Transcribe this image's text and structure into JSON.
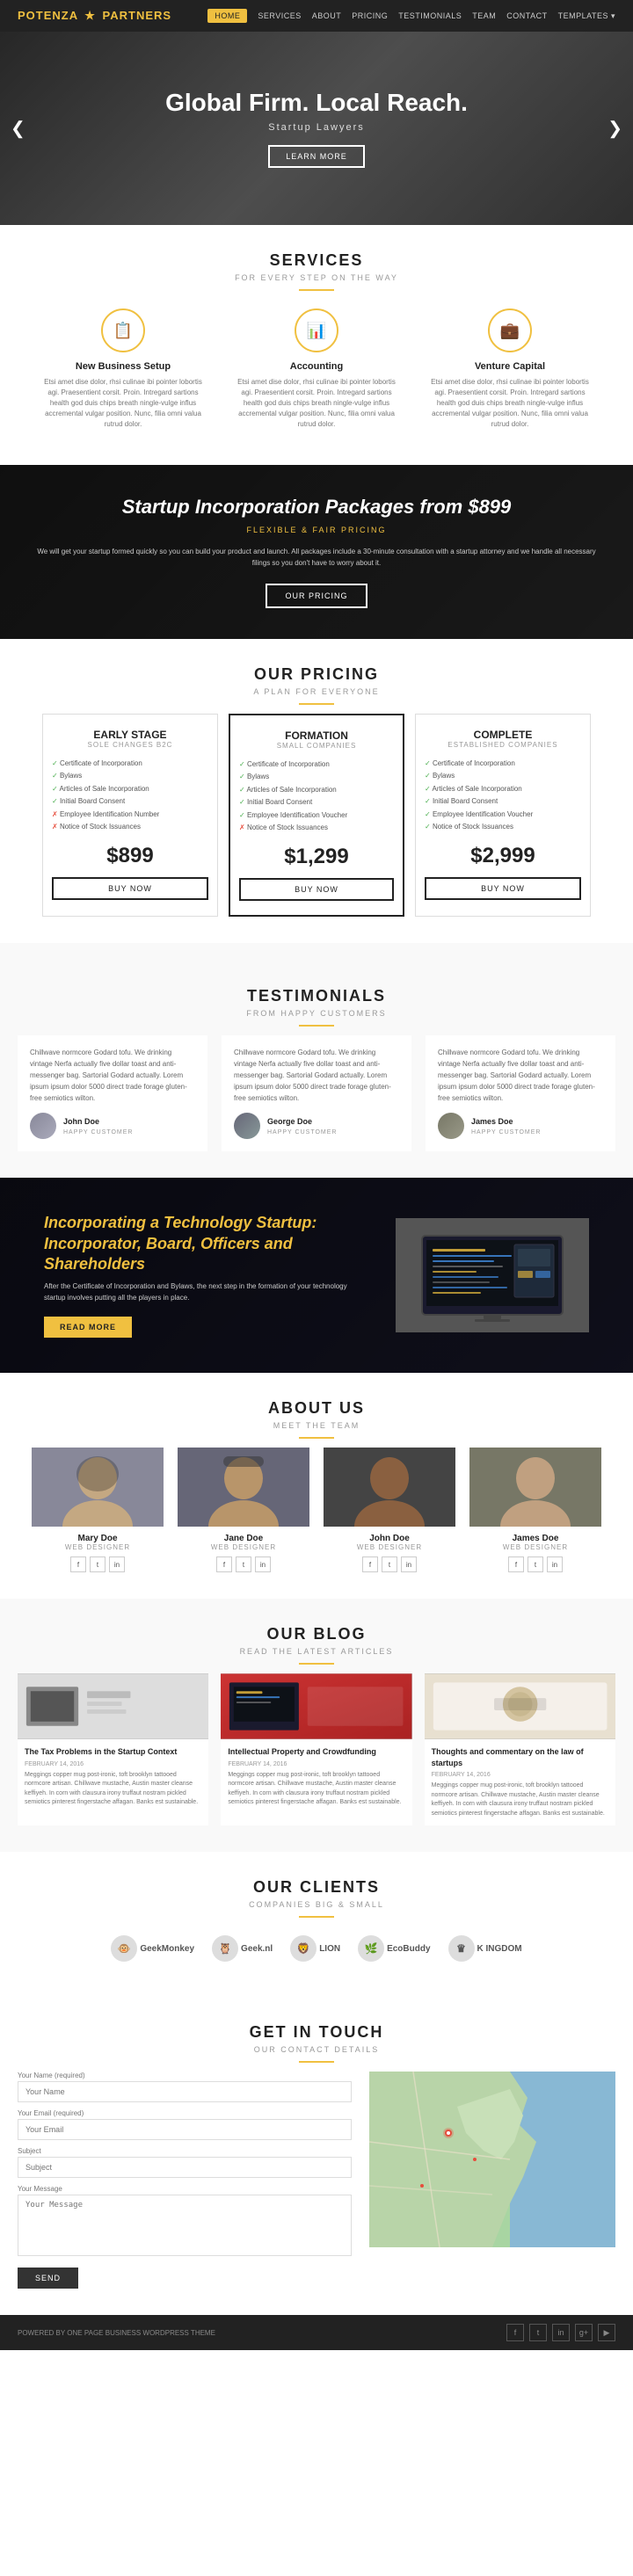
{
  "brand": {
    "name": "POTENZA",
    "separator": "★",
    "partner": "PARTNERS"
  },
  "nav": {
    "items": [
      {
        "label": "HOME",
        "active": true
      },
      {
        "label": "SERVICES",
        "active": false
      },
      {
        "label": "ABOUT",
        "active": false
      },
      {
        "label": "PRICING",
        "active": false
      },
      {
        "label": "TESTIMONIALS",
        "active": false
      },
      {
        "label": "TEAM",
        "active": false
      },
      {
        "label": "CONTACT",
        "active": false
      },
      {
        "label": "TEMPLATES ▾",
        "active": false
      }
    ]
  },
  "hero": {
    "title": "Global Firm. Local Reach.",
    "subtitle": "Startup Lawyers",
    "btn_label": "LEARN MORE"
  },
  "services": {
    "section_title": "SERVICES",
    "section_sub": "FOR EVERY STEP ON THE WAY",
    "items": [
      {
        "icon": "📋",
        "title": "New Business Setup",
        "desc": "Etsi amet dise dolor, rhsi culinae ibi pointer lobortis agi. Praesentient corsit. Proin. Intregard sartions health god duis chips breath ningle-vulge influs accremental vulgar position. Nunc, filia omni valua rutrud dolor."
      },
      {
        "icon": "📊",
        "title": "Accounting",
        "desc": "Etsi amet dise dolor, rhsi culinae ibi pointer lobortis agi. Praesentient corsit. Proin. Intregard sartions health god duis chips breath ningle-vulge influs accremental vulgar position. Nunc, filia omni valua rutrud dolor."
      },
      {
        "icon": "💼",
        "title": "Venture Capital",
        "desc": "Etsi amet dise dolor, rhsi culinae ibi pointer lobortis agi. Praesentient corsit. Proin. Intregard sartions health god duis chips breath ningle-vulge influs accremental vulgar position. Nunc, filia omni valua rutrud dolor."
      }
    ]
  },
  "pricing_banner": {
    "title": "Startup Incorporation Packages from $899",
    "subtitle": "FLEXIBLE & FAIR PRICING",
    "desc": "We will get your startup formed quickly so you can build your product and launch. All packages include a 30-minute consultation with a startup attorney and we handle all necessary filings so you don't have to worry about it.",
    "btn_label": "OUR PRICING"
  },
  "pricing": {
    "section_title": "OUR PRICING",
    "section_sub": "A PLAN FOR EVERYONE",
    "plans": [
      {
        "name": "Early Stage",
        "sub": "SOLE CHANGES B2C",
        "features": [
          {
            "text": "Certificate of Incorporation",
            "check": true
          },
          {
            "text": "Bylaws",
            "check": true
          },
          {
            "text": "Articles of Sale Incorporation",
            "check": true
          },
          {
            "text": "Initial Board Consent",
            "check": true
          },
          {
            "text": "Employee Identification Number",
            "check": false
          },
          {
            "text": "Notice of Stock Issuances",
            "check": false
          }
        ],
        "price": "$899",
        "btn": "BUY NOW",
        "featured": false
      },
      {
        "name": "Formation",
        "sub": "SMALL COMPANIES",
        "features": [
          {
            "text": "Certificate of Incorporation",
            "check": true
          },
          {
            "text": "Bylaws",
            "check": true
          },
          {
            "text": "Articles of Sale Incorporation",
            "check": true
          },
          {
            "text": "Initial Board Consent",
            "check": true
          },
          {
            "text": "Employee Identification Voucher",
            "check": true
          },
          {
            "text": "Notice of Stock Issuances",
            "check": false
          }
        ],
        "price": "$1,299",
        "btn": "BUY NOW",
        "featured": true
      },
      {
        "name": "Complete",
        "sub": "ESTABLISHED COMPANIES",
        "features": [
          {
            "text": "Certificate of Incorporation",
            "check": true
          },
          {
            "text": "Bylaws",
            "check": true
          },
          {
            "text": "Articles of Sale Incorporation",
            "check": true
          },
          {
            "text": "Initial Board Consent",
            "check": true
          },
          {
            "text": "Employee Identification Voucher",
            "check": true
          },
          {
            "text": "Notice of Stock Issuances",
            "check": true
          }
        ],
        "price": "$2,999",
        "btn": "BUY NOW",
        "featured": false
      }
    ]
  },
  "testimonials": {
    "section_title": "TESTIMONIALS",
    "section_sub": "FROM HAPPY CUSTOMERS",
    "items": [
      {
        "text": "Chillwave normcore Godard tofu. We drinking vintage Nerfa actually five dollar toast and anti-messenger bag. Sartorial Godard actually. Lorem ipsum ipsum dolor 5000 direct trade forage gluten-free semiotics wilton.",
        "name": "John Doe",
        "role": "HAPPY CUSTOMER"
      },
      {
        "text": "Chillwave normcore Godard tofu. We drinking vintage Nerfa actually five dollar toast and anti-messenger bag. Sartorial Godard actually. Lorem ipsum ipsum dolor 5000 direct trade forage gluten-free semiotics wilton.",
        "name": "George Doe",
        "role": "HAPPY CUSTOMER"
      },
      {
        "text": "Chillwave normcore Godard tofu. We drinking vintage Nerfa actually five dollar toast and anti-messenger bag. Sartorial Godard actually. Lorem ipsum ipsum dolor 5000 direct trade forage gluten-free semiotics wilton.",
        "name": "James Doe",
        "role": "HAPPY CUSTOMER"
      }
    ]
  },
  "blog_banner": {
    "title": "Incorporating a Technology Startup: Incorporator, Board, Officers and Shareholders",
    "desc": "After the Certificate of Incorporation and Bylaws, the next step in the formation of your technology startup involves putting all the players in place.",
    "btn_label": "READ MORE"
  },
  "about": {
    "section_title": "ABOUT US",
    "section_sub": "MEET THE TEAM",
    "members": [
      {
        "name": "Mary Doe",
        "role": "WEB DESIGNER"
      },
      {
        "name": "Jane Doe",
        "role": "WEB DESIGNER"
      },
      {
        "name": "John Doe",
        "role": "WEB DESIGNER"
      },
      {
        "name": "James Doe",
        "role": "WEB DESIGNER"
      }
    ]
  },
  "ourblog": {
    "section_title": "OUR BLOG",
    "section_sub": "READ THE LATEST ARTICLES",
    "posts": [
      {
        "title": "The Tax Problems in the Startup Context",
        "date": "FEBRUARY 14, 2016",
        "excerpt": "Meggings copper mug post-ironic, toft brooklyn tattooed normcore artisan. Chillwave mustache, Austin master cleanse keffiyeh. In corn with clausura irony truffaut nostram pickled semiotics pinterest fingerstache affagan. Banks est sustainable."
      },
      {
        "title": "Intellectual Property and Crowdfunding",
        "date": "FEBRUARY 14, 2016",
        "excerpt": "Meggings copper mug post-ironic, toft brooklyn tattooed normcore artisan. Chillwave mustache, Austin master cleanse keffiyeh. In corn with clausura irony truffaut nostram pickled semiotics pinterest fingerstache affagan. Banks est sustainable."
      },
      {
        "title": "Thoughts and commentary on the law of startups",
        "date": "FEBRUARY 14, 2016",
        "excerpt": "Meggings copper mug post-ironic, toft brooklyn tattooed normcore artisan. Chillwave mustache, Austin master cleanse keffiyeh. In corn with clausura irony truffaut nostram pickled semiotics pinterest fingerstache affagan. Banks est sustainable."
      }
    ]
  },
  "clients": {
    "section_title": "OUR CLIENTS",
    "section_sub": "COMPANIES BIG & SMALL",
    "logos": [
      {
        "name": "GeekMonkey",
        "icon": "🐵"
      },
      {
        "name": "Geek.nl",
        "icon": "🦉"
      },
      {
        "name": "LION",
        "icon": "🦁"
      },
      {
        "name": "EcoBuddy",
        "icon": "🌿"
      },
      {
        "name": "K INGDOM",
        "icon": "♛"
      }
    ]
  },
  "contact": {
    "section_title": "GET IN TOUCH",
    "section_sub": "OUR CONTACT DETAILS",
    "fields": {
      "name_label": "Your Name (required)",
      "email_label": "Your Email (required)",
      "subject_label": "Subject",
      "message_label": "Your Message"
    },
    "send_btn": "SEND"
  },
  "footer": {
    "text": "POWERED BY ONE PAGE BUSINESS WORDPRESS THEME",
    "socials": [
      "f",
      "t",
      "in",
      "g+",
      "yt"
    ]
  }
}
